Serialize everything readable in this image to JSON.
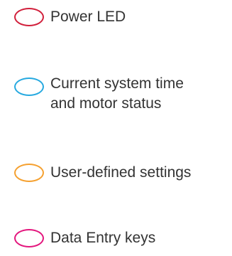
{
  "legend": {
    "items": [
      {
        "label": "Power LED",
        "color": "#d11f3b"
      },
      {
        "label": "Current system time and motor status",
        "line1": "Current system time",
        "line2": "and motor status",
        "color": "#26a9e0"
      },
      {
        "label": "User-defined settings",
        "color": "#f5a02f"
      },
      {
        "label": "Data Entry keys",
        "color": "#e3167d"
      }
    ]
  }
}
